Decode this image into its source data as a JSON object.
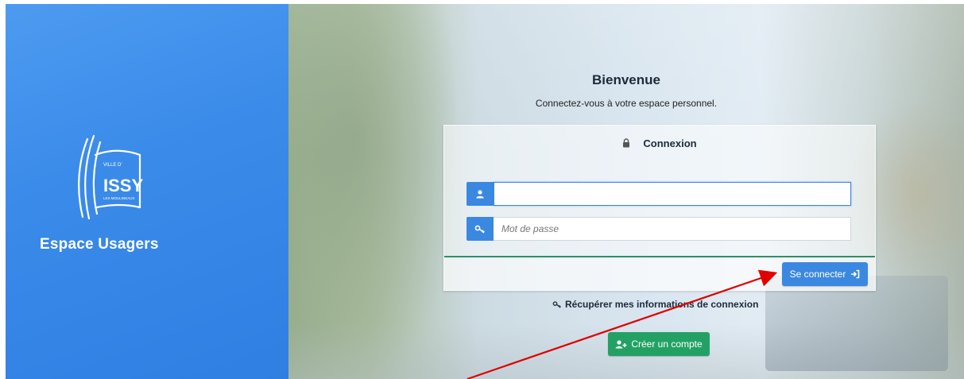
{
  "sidebar": {
    "logo_text_top": "VILLE D'",
    "logo_text_main": "ISSY",
    "logo_text_bottom": "LES MOULINEAUX",
    "brand": "Espace Usagers"
  },
  "main": {
    "title": "Bienvenue",
    "subtitle": "Connectez-vous à votre espace personnel."
  },
  "login_panel": {
    "header": "Connexion",
    "username_value": "",
    "password_placeholder": "Mot de passe",
    "submit_label": "Se connecter"
  },
  "links": {
    "recover_label": "Récupérer mes informations de connexion",
    "create_account_label": "Créer un compte"
  },
  "icons": {
    "lock": "lock-icon",
    "user": "user-icon",
    "key": "key-icon",
    "sign_in": "sign-in-icon",
    "user_plus": "user-plus-icon"
  },
  "colors": {
    "sidebar": "#3b8bea",
    "primary": "#3b88e0",
    "success": "#23a165",
    "annotation_arrow": "#e00000"
  }
}
